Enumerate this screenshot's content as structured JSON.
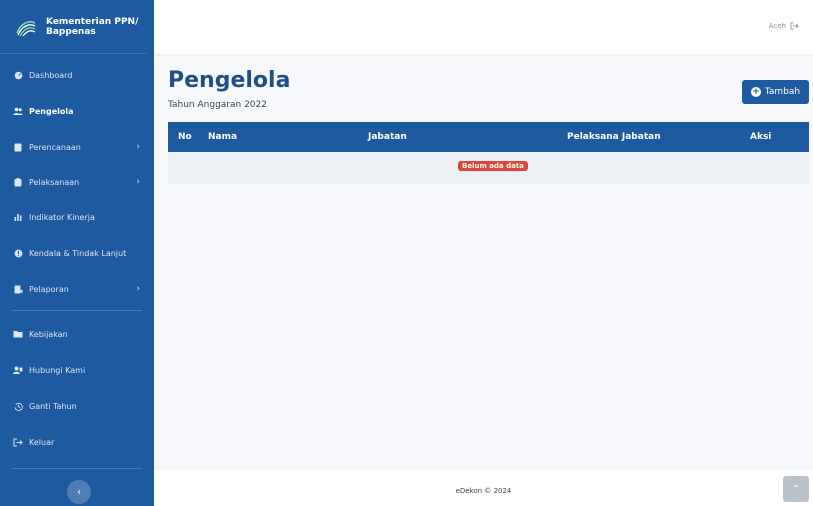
{
  "brand": {
    "line1": "Kementerian PPN/",
    "line2": "Bappenas"
  },
  "topbar": {
    "user": "Aceh"
  },
  "sidebar": {
    "items": [
      {
        "label": "Dashboard",
        "icon": "dashboard-icon"
      },
      {
        "label": "Pengelola",
        "icon": "users-icon",
        "active": true
      },
      {
        "label": "Perencanaan",
        "icon": "document-icon",
        "has_children": true
      },
      {
        "label": "Pelaksanaan",
        "icon": "clipboard-icon",
        "has_children": true
      },
      {
        "label": "Indikator Kinerja",
        "icon": "bar-chart-icon"
      },
      {
        "label": "Kendala & Tindak Lanjut",
        "icon": "alert-icon"
      },
      {
        "label": "Pelaporan",
        "icon": "report-icon",
        "has_children": true
      },
      {
        "label": "Kebijakan",
        "icon": "folder-icon"
      },
      {
        "label": "Hubungi Kami",
        "icon": "contacts-icon"
      },
      {
        "label": "Ganti Tahun",
        "icon": "history-icon"
      },
      {
        "label": "Keluar",
        "icon": "logout-icon"
      }
    ]
  },
  "main": {
    "title": "Pengelola",
    "subtitle": "Tahun Anggaran 2022",
    "add_button": "Tambah",
    "table": {
      "headers": [
        "No",
        "Nama",
        "Jabatan",
        "Pelaksana Jabatan",
        "Aksi"
      ],
      "empty_message": "Belum ada data"
    }
  },
  "footer": {
    "text": "eDekon © 2024"
  },
  "colors": {
    "primary": "#1d5a9f",
    "badge": "#e0453a"
  }
}
